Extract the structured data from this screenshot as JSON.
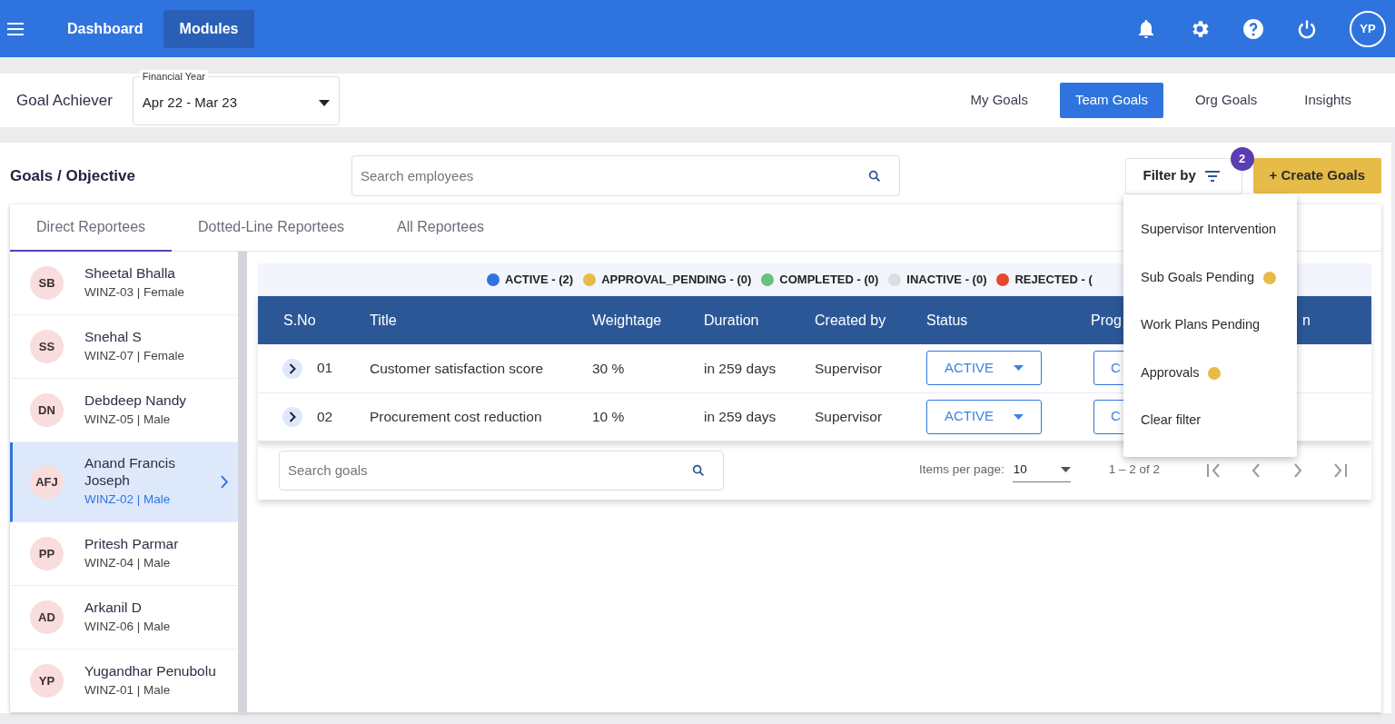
{
  "nav": {
    "items": [
      {
        "label": "Dashboard",
        "selected": false
      },
      {
        "label": "Modules",
        "selected": true
      }
    ],
    "avatar": "YP"
  },
  "subheader": {
    "title": "Goal Achiever",
    "financial_year": {
      "label": "Financial Year",
      "value": "Apr 22 - Mar 23"
    },
    "tabs": [
      {
        "label": "My Goals",
        "selected": false
      },
      {
        "label": "Team Goals",
        "selected": true
      },
      {
        "label": "Org Goals",
        "selected": false
      },
      {
        "label": "Insights",
        "selected": false
      }
    ]
  },
  "section": {
    "title": "Goals / Objective",
    "search": {
      "placeholder": "Search employees"
    },
    "filter": {
      "label": "Filter by",
      "badge": "2"
    },
    "create_button": "+ Create Goals"
  },
  "reportee_tabs": [
    {
      "label": "Direct Reportees",
      "selected": true
    },
    {
      "label": "Dotted-Line Reportees",
      "selected": false
    },
    {
      "label": "All Reportees",
      "selected": false
    }
  ],
  "employees": [
    {
      "initials": "SB",
      "name": "Sheetal Bhalla",
      "meta": "WINZ-03 | Female",
      "selected": false
    },
    {
      "initials": "SS",
      "name": "Snehal S",
      "meta": "WINZ-07 | Female",
      "selected": false
    },
    {
      "initials": "DN",
      "name": "Debdeep Nandy",
      "meta": "WINZ-05 | Male",
      "selected": false
    },
    {
      "initials": "AFJ",
      "name": "Anand Francis Joseph",
      "meta": "WINZ-02 | Male",
      "selected": true
    },
    {
      "initials": "PP",
      "name": "Pritesh Parmar",
      "meta": "WINZ-04 | Male",
      "selected": false
    },
    {
      "initials": "AD",
      "name": "Arkanil D",
      "meta": "WINZ-06 | Male",
      "selected": false
    },
    {
      "initials": "YP",
      "name": "Yugandhar Penubolu",
      "meta": "WINZ-01 | Male",
      "selected": false
    }
  ],
  "legend": [
    {
      "label": "ACTIVE - (2)",
      "color": "#2f74de"
    },
    {
      "label": "APPROVAL_PENDING - (0)",
      "color": "#e6bb47"
    },
    {
      "label": "COMPLETED - (0)",
      "color": "#6cc07a"
    },
    {
      "label": "INACTIVE - (0)",
      "color": "#dcdde0"
    },
    {
      "label": "REJECTED - (",
      "color": "#e5472f"
    }
  ],
  "table": {
    "columns": [
      "S.No",
      "Title",
      "Weightage",
      "Duration",
      "Created by",
      "Status",
      "Prog",
      "n"
    ],
    "rows": [
      {
        "sno": "01",
        "title": "Customer satisfaction score",
        "weightage": "30 %",
        "duration": "in 259 days",
        "created_by": "Supervisor",
        "status": "ACTIVE",
        "progress": "C"
      },
      {
        "sno": "02",
        "title": "Procurement cost reduction",
        "weightage": "10 %",
        "duration": "in 259 days",
        "created_by": "Supervisor",
        "status": "ACTIVE",
        "progress": "C"
      }
    ]
  },
  "footer": {
    "search": {
      "placeholder": "Search goals"
    },
    "items_per_page_label": "Items per page:",
    "items_per_page": "10",
    "range": "1 – 2 of 2"
  },
  "filter_menu": [
    {
      "label": "Supervisor Intervention"
    },
    {
      "label": "Sub Goals Pending",
      "color": "#e6bb47"
    },
    {
      "label": "Work Plans Pending"
    },
    {
      "label": "Approvals",
      "color": "#e6bb47"
    },
    {
      "label": "Clear filter"
    }
  ]
}
